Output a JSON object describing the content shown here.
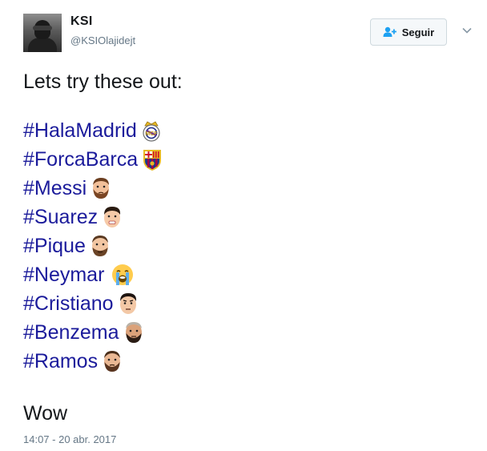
{
  "author": {
    "name": "KSI",
    "handle": "@KSIOlajidejt"
  },
  "follow_button": {
    "label": "Seguir",
    "icon": "add-user-icon"
  },
  "menu": {
    "icon": "chevron-down-icon"
  },
  "tweet": {
    "intro": "Lets try these out:",
    "hashtags": [
      {
        "text": "#HalaMadrid",
        "emoji": "real-madrid-crest-icon"
      },
      {
        "text": "#ForcaBarca",
        "emoji": "fc-barcelona-crest-icon"
      },
      {
        "text": "#Messi",
        "emoji": "messi-face-icon"
      },
      {
        "text": "#Suarez",
        "emoji": "suarez-face-icon"
      },
      {
        "text": "#Pique",
        "emoji": "pique-face-icon"
      },
      {
        "text": "#Neymar",
        "emoji": "loudly-crying-face-icon"
      },
      {
        "text": "#Cristiano",
        "emoji": "cristiano-face-icon"
      },
      {
        "text": "#Benzema",
        "emoji": "benzema-face-icon"
      },
      {
        "text": "#Ramos",
        "emoji": "ramos-face-icon"
      }
    ],
    "outro": "Wow",
    "timestamp": "14:07 - 20 abr. 2017"
  },
  "colors": {
    "hashtag": "#1b1b9b",
    "text": "#14171a",
    "secondary": "#657786",
    "follow_icon": "#1da1f2"
  }
}
